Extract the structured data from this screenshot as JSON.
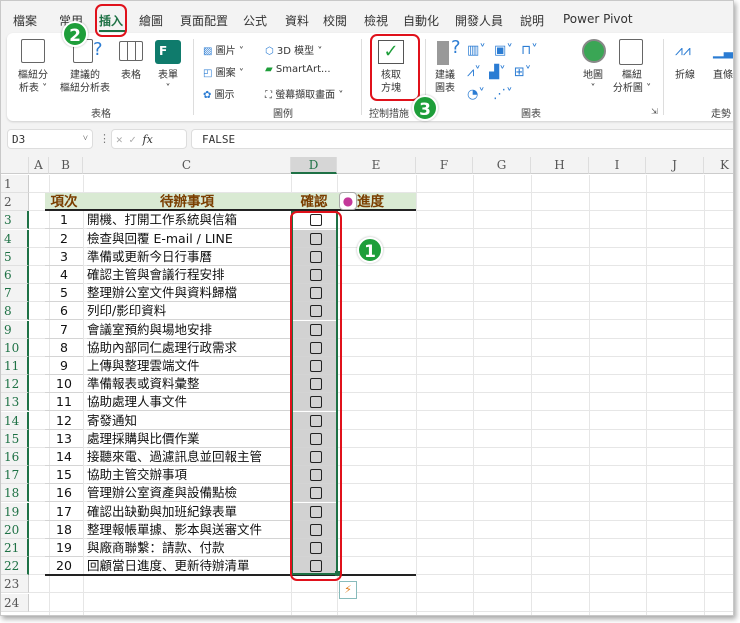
{
  "tabs": [
    "檔案",
    "常用",
    "插入",
    "繪圖",
    "頁面配置",
    "公式",
    "資料",
    "校閱",
    "檢視",
    "自動化",
    "開發人員",
    "說明",
    "Power Pivot"
  ],
  "active_tab": "插入",
  "ribbon": {
    "tables_group": {
      "label": "表格",
      "pivot": "樞紐分\n析表 ˅",
      "recommended_pivot": "建議的\n樞紐分析表",
      "table": "表格",
      "forms": "表單\n˅"
    },
    "illustrations_group": {
      "label": "圖例",
      "pictures": "圖片 ˅",
      "shapes": "圖案 ˅",
      "icons": "圖示",
      "models3d": "3D 模型  ˅",
      "smartart": "SmartArt...",
      "screenshot": "螢幕擷取畫面 ˅"
    },
    "controls_group": {
      "label": "控制措施",
      "checkbox": "核取\n方塊"
    },
    "charts_group": {
      "label": "圖表",
      "recommended": "建議\n圖表",
      "maps": "地圖\n˅",
      "pivot_chart": "樞紐\n分析圖 ˅"
    },
    "sparklines_group": {
      "label": "走勢",
      "line": "折線",
      "column": "直條"
    }
  },
  "formula_bar": {
    "name_box": "D3",
    "value": "FALSE",
    "fx": "fx"
  },
  "columns": [
    "A",
    "B",
    "C",
    "D",
    "E",
    "F",
    "G",
    "H",
    "I",
    "J",
    "K"
  ],
  "rows": [
    "1",
    "2",
    "3",
    "4",
    "5",
    "6",
    "7",
    "8",
    "9",
    "10",
    "11",
    "12",
    "13",
    "14",
    "15",
    "16",
    "17",
    "18",
    "19",
    "20",
    "21",
    "22",
    "23",
    "24"
  ],
  "table": {
    "headers": [
      "項次",
      "待辦事項",
      "確認",
      "進度"
    ],
    "items": [
      [
        "1",
        "開機、打開工作系統與信箱"
      ],
      [
        "2",
        "檢查與回覆 E-mail / LINE"
      ],
      [
        "3",
        "準備或更新今日行事曆"
      ],
      [
        "4",
        "確認主管與會議行程安排"
      ],
      [
        "5",
        "整理辦公室文件與資料歸檔"
      ],
      [
        "6",
        "列印/影印資料"
      ],
      [
        "7",
        "會議室預約與場地安排"
      ],
      [
        "8",
        "協助內部同仁處理行政需求"
      ],
      [
        "9",
        "上傳與整理雲端文件"
      ],
      [
        "10",
        "準備報表或資料彙整"
      ],
      [
        "11",
        "協助處理人事文件"
      ],
      [
        "12",
        "寄發通知"
      ],
      [
        "13",
        "處理採購與比價作業"
      ],
      [
        "14",
        "接聽來電、過濾訊息並回報主管"
      ],
      [
        "15",
        "協助主管交辦事項"
      ],
      [
        "16",
        "管理辦公室資產與設備點檢"
      ],
      [
        "17",
        "確認出缺勤與加班紀錄表單"
      ],
      [
        "18",
        "整理報帳單據、影本與送審文件"
      ],
      [
        "19",
        "與廠商聯繫：請款、付款"
      ],
      [
        "20",
        "回顧當日進度、更新待辦清單"
      ]
    ],
    "checked": [
      false,
      false,
      false,
      false,
      false,
      false,
      false,
      false,
      false,
      false,
      false,
      false,
      false,
      false,
      false,
      false,
      false,
      false,
      false,
      false
    ]
  },
  "annotations": [
    "1",
    "2",
    "3"
  ],
  "colors": {
    "header_bg": "#d9ead3",
    "header_text": "#7a3e00",
    "accent": "#1e7145",
    "highlight": "#e0111b",
    "badge": "#1e9e3a"
  }
}
